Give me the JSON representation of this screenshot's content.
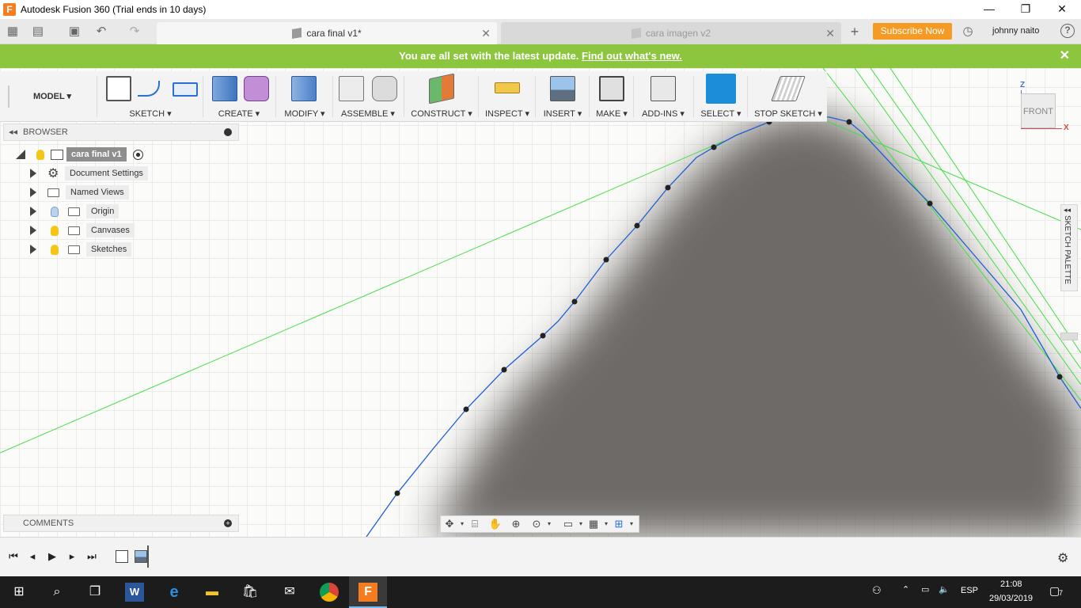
{
  "window": {
    "title": "Autodesk Fusion 360 (Trial ends in 10 days)",
    "minimize": "—",
    "maximize": "❐",
    "close": "✕"
  },
  "tabs": [
    {
      "label": "cara final v1*"
    },
    {
      "label": "cara imagen v2"
    }
  ],
  "header": {
    "subscribe": "Subscribe Now",
    "user": "johnny naito",
    "help": "?"
  },
  "banner": {
    "text": "You are all set with the latest update.",
    "link": "Find out what's new.",
    "close": "✕"
  },
  "toolbar": {
    "workspace": "MODEL ▾",
    "groups": [
      {
        "label": "SKETCH ▾"
      },
      {
        "label": "CREATE ▾"
      },
      {
        "label": "MODIFY ▾"
      },
      {
        "label": "ASSEMBLE ▾"
      },
      {
        "label": "CONSTRUCT ▾"
      },
      {
        "label": "INSPECT ▾"
      },
      {
        "label": "INSERT ▾"
      },
      {
        "label": "MAKE ▾"
      },
      {
        "label": "ADD-INS ▾"
      },
      {
        "label": "SELECT ▾"
      },
      {
        "label": "STOP SKETCH ▾"
      }
    ]
  },
  "browser": {
    "title": "BROWSER",
    "root": "cara final v1",
    "items": [
      {
        "label": "Document Settings",
        "icon": "gear-icon"
      },
      {
        "label": "Named Views",
        "icon": "folder-icon"
      },
      {
        "label": "Origin",
        "icon": "folder-icon"
      },
      {
        "label": "Canvases",
        "icon": "folder-icon"
      },
      {
        "label": "Sketches",
        "icon": "folder-icon"
      }
    ]
  },
  "comments": {
    "title": "COMMENTS"
  },
  "viewcube": {
    "face": "FRONT",
    "axis_z": "Z",
    "axis_x": "X"
  },
  "sketch_palette": {
    "label": "SKETCH PALETTE"
  },
  "taskbar": {
    "lang": "ESP",
    "time": "21:08",
    "date": "29/03/2019",
    "notifications": "7"
  },
  "colors": {
    "banner": "#8cc63f",
    "subscribe": "#f59a23",
    "spline": "#1e5fd6",
    "construction": "#44dd44"
  }
}
